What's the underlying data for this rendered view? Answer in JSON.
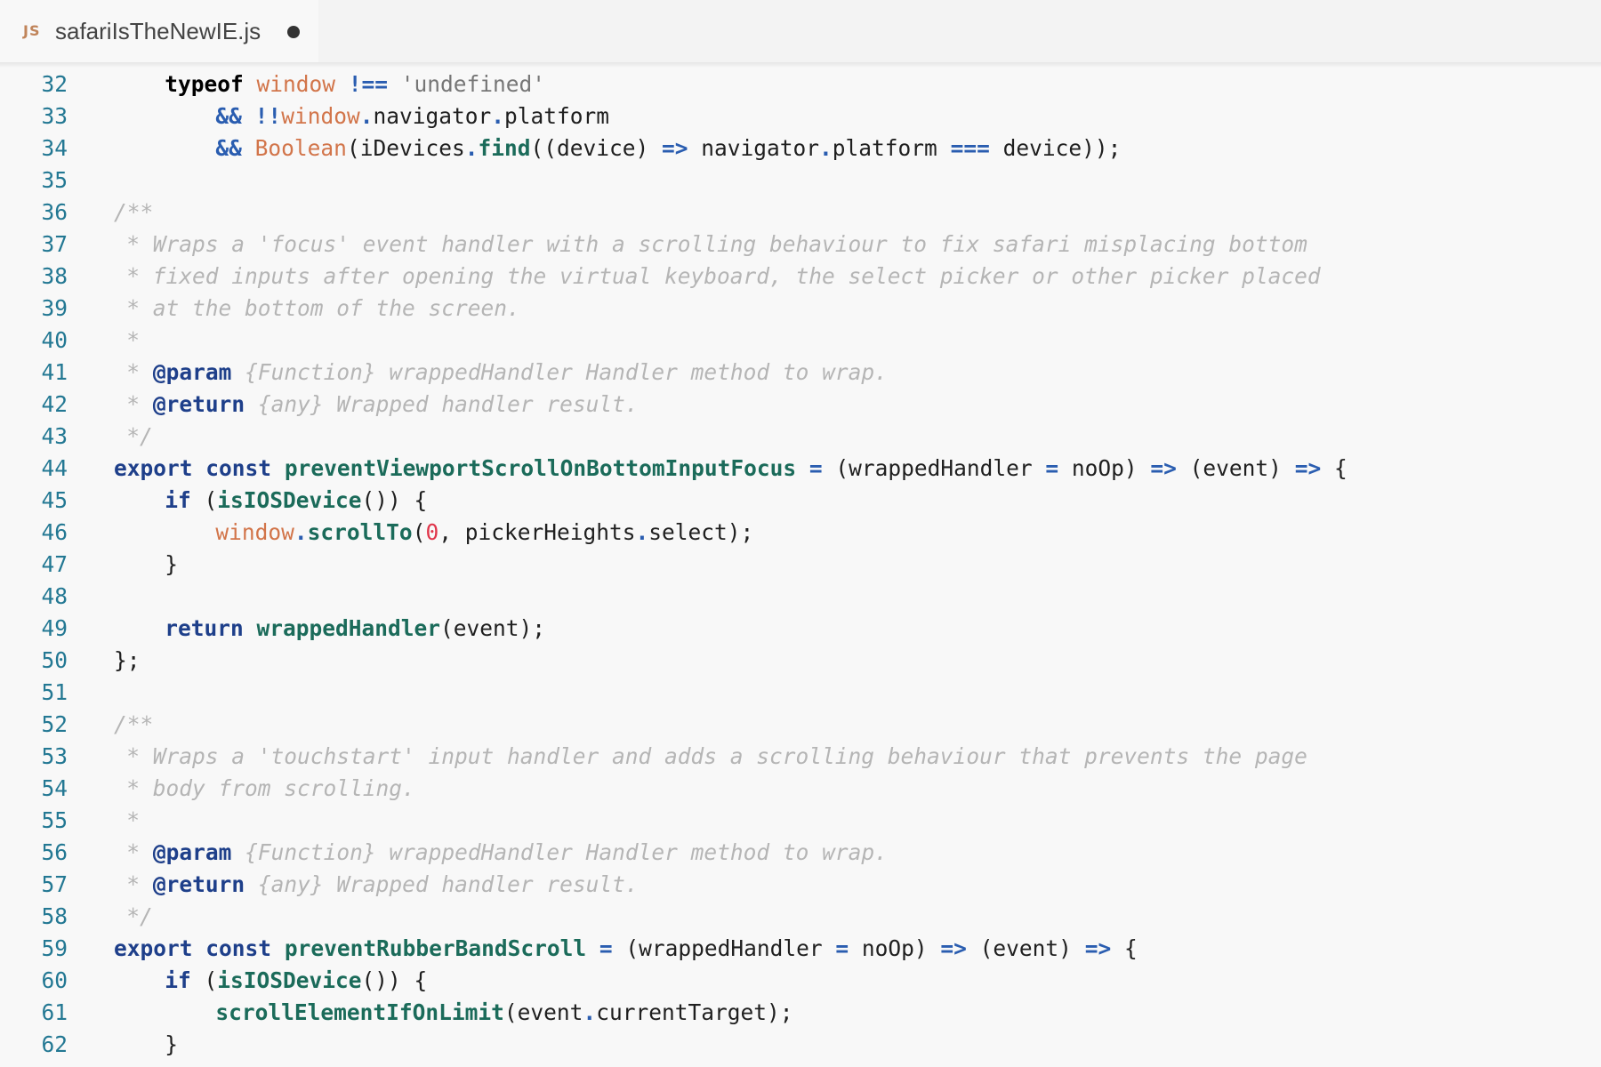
{
  "tab": {
    "icon_label": "JS",
    "title": "safariIsTheNewIE.js",
    "modified": true
  },
  "colors": {
    "line_number": "#237893",
    "keyword": "#1e3f8a",
    "function": "#1b6b5a",
    "global": "#d2754a",
    "string": "#767676",
    "number": "#e0364b",
    "comment": "#b5b5b5"
  },
  "lines": [
    {
      "n": "32",
      "indent": 4,
      "tokens": [
        [
          "kw2",
          "typeof"
        ],
        [
          "p",
          " "
        ],
        [
          "gl",
          "window"
        ],
        [
          "p",
          " "
        ],
        [
          "op",
          "!=="
        ],
        [
          "p",
          " "
        ],
        [
          "str",
          "'undefined'"
        ]
      ]
    },
    {
      "n": "33",
      "indent": 8,
      "tokens": [
        [
          "op",
          "&&"
        ],
        [
          "p",
          " "
        ],
        [
          "op",
          "!!"
        ],
        [
          "gl",
          "window"
        ],
        [
          "op",
          "."
        ],
        [
          "p",
          "navigator"
        ],
        [
          "op",
          "."
        ],
        [
          "p",
          "platform"
        ]
      ]
    },
    {
      "n": "34",
      "indent": 8,
      "tokens": [
        [
          "op",
          "&&"
        ],
        [
          "p",
          " "
        ],
        [
          "gl",
          "Boolean"
        ],
        [
          "p",
          "(iDevices"
        ],
        [
          "op",
          "."
        ],
        [
          "fn",
          "find"
        ],
        [
          "p",
          "((device) "
        ],
        [
          "op",
          "=>"
        ],
        [
          "p",
          " navigator"
        ],
        [
          "op",
          "."
        ],
        [
          "p",
          "platform "
        ],
        [
          "op",
          "==="
        ],
        [
          "p",
          " device));"
        ]
      ]
    },
    {
      "n": "35",
      "indent": 0,
      "tokens": []
    },
    {
      "n": "36",
      "indent": 0,
      "tokens": [
        [
          "cm",
          "/**"
        ]
      ]
    },
    {
      "n": "37",
      "indent": 1,
      "tokens": [
        [
          "cm",
          "* Wraps a 'focus' event handler with a scrolling behaviour to fix safari misplacing bottom"
        ]
      ]
    },
    {
      "n": "38",
      "indent": 1,
      "tokens": [
        [
          "cm",
          "* fixed inputs after opening the virtual keyboard, the select picker or other picker placed"
        ]
      ]
    },
    {
      "n": "39",
      "indent": 1,
      "tokens": [
        [
          "cm",
          "* at the bottom of the screen."
        ]
      ]
    },
    {
      "n": "40",
      "indent": 1,
      "tokens": [
        [
          "cm",
          "*"
        ]
      ]
    },
    {
      "n": "41",
      "indent": 1,
      "tokens": [
        [
          "cm",
          "* "
        ],
        [
          "tag",
          "@param"
        ],
        [
          "cm",
          " "
        ],
        [
          "ty",
          "{Function}"
        ],
        [
          "cm",
          " wrappedHandler Handler method to wrap."
        ]
      ]
    },
    {
      "n": "42",
      "indent": 1,
      "tokens": [
        [
          "cm",
          "* "
        ],
        [
          "tag",
          "@return"
        ],
        [
          "cm",
          " "
        ],
        [
          "ty",
          "{any}"
        ],
        [
          "cm",
          " Wrapped handler result."
        ]
      ]
    },
    {
      "n": "43",
      "indent": 1,
      "tokens": [
        [
          "cm",
          "*/"
        ]
      ]
    },
    {
      "n": "44",
      "indent": 0,
      "tokens": [
        [
          "kw",
          "export"
        ],
        [
          "p",
          " "
        ],
        [
          "kw",
          "const"
        ],
        [
          "p",
          " "
        ],
        [
          "fn",
          "preventViewportScrollOnBottomInputFocus"
        ],
        [
          "p",
          " "
        ],
        [
          "op",
          "="
        ],
        [
          "p",
          " (wrappedHandler "
        ],
        [
          "op",
          "="
        ],
        [
          "p",
          " noOp) "
        ],
        [
          "op",
          "=>"
        ],
        [
          "p",
          " (event) "
        ],
        [
          "op",
          "=>"
        ],
        [
          "p",
          " {"
        ]
      ]
    },
    {
      "n": "45",
      "indent": 4,
      "tokens": [
        [
          "kw",
          "if"
        ],
        [
          "p",
          " ("
        ],
        [
          "fn",
          "isIOSDevice"
        ],
        [
          "p",
          "()) {"
        ]
      ]
    },
    {
      "n": "46",
      "indent": 8,
      "tokens": [
        [
          "gl",
          "window"
        ],
        [
          "op",
          "."
        ],
        [
          "fn",
          "scrollTo"
        ],
        [
          "p",
          "("
        ],
        [
          "num",
          "0"
        ],
        [
          "p",
          ", pickerHeights"
        ],
        [
          "op",
          "."
        ],
        [
          "p",
          "select);"
        ]
      ]
    },
    {
      "n": "47",
      "indent": 4,
      "tokens": [
        [
          "p",
          "}"
        ]
      ]
    },
    {
      "n": "48",
      "indent": 0,
      "tokens": []
    },
    {
      "n": "49",
      "indent": 4,
      "tokens": [
        [
          "kw",
          "return"
        ],
        [
          "p",
          " "
        ],
        [
          "fn",
          "wrappedHandler"
        ],
        [
          "p",
          "(event);"
        ]
      ]
    },
    {
      "n": "50",
      "indent": 0,
      "tokens": [
        [
          "p",
          "};"
        ]
      ]
    },
    {
      "n": "51",
      "indent": 0,
      "tokens": []
    },
    {
      "n": "52",
      "indent": 0,
      "tokens": [
        [
          "cm",
          "/**"
        ]
      ]
    },
    {
      "n": "53",
      "indent": 1,
      "tokens": [
        [
          "cm",
          "* Wraps a 'touchstart' input handler and adds a scrolling behaviour that prevents the page"
        ]
      ]
    },
    {
      "n": "54",
      "indent": 1,
      "tokens": [
        [
          "cm",
          "* body from scrolling."
        ]
      ]
    },
    {
      "n": "55",
      "indent": 1,
      "tokens": [
        [
          "cm",
          "*"
        ]
      ]
    },
    {
      "n": "56",
      "indent": 1,
      "tokens": [
        [
          "cm",
          "* "
        ],
        [
          "tag",
          "@param"
        ],
        [
          "cm",
          " "
        ],
        [
          "ty",
          "{Function}"
        ],
        [
          "cm",
          " wrappedHandler Handler method to wrap."
        ]
      ]
    },
    {
      "n": "57",
      "indent": 1,
      "tokens": [
        [
          "cm",
          "* "
        ],
        [
          "tag",
          "@return"
        ],
        [
          "cm",
          " "
        ],
        [
          "ty",
          "{any}"
        ],
        [
          "cm",
          " Wrapped handler result."
        ]
      ]
    },
    {
      "n": "58",
      "indent": 1,
      "tokens": [
        [
          "cm",
          "*/"
        ]
      ]
    },
    {
      "n": "59",
      "indent": 0,
      "tokens": [
        [
          "kw",
          "export"
        ],
        [
          "p",
          " "
        ],
        [
          "kw",
          "const"
        ],
        [
          "p",
          " "
        ],
        [
          "fn",
          "preventRubberBandScroll"
        ],
        [
          "p",
          " "
        ],
        [
          "op",
          "="
        ],
        [
          "p",
          " (wrappedHandler "
        ],
        [
          "op",
          "="
        ],
        [
          "p",
          " noOp) "
        ],
        [
          "op",
          "=>"
        ],
        [
          "p",
          " (event) "
        ],
        [
          "op",
          "=>"
        ],
        [
          "p",
          " {"
        ]
      ]
    },
    {
      "n": "60",
      "indent": 4,
      "tokens": [
        [
          "kw",
          "if"
        ],
        [
          "p",
          " ("
        ],
        [
          "fn",
          "isIOSDevice"
        ],
        [
          "p",
          "()) {"
        ]
      ]
    },
    {
      "n": "61",
      "indent": 8,
      "tokens": [
        [
          "fn",
          "scrollElementIfOnLimit"
        ],
        [
          "p",
          "(event"
        ],
        [
          "op",
          "."
        ],
        [
          "p",
          "currentTarget);"
        ]
      ]
    },
    {
      "n": "62",
      "indent": 4,
      "tokens": [
        [
          "p",
          "}"
        ]
      ]
    }
  ]
}
